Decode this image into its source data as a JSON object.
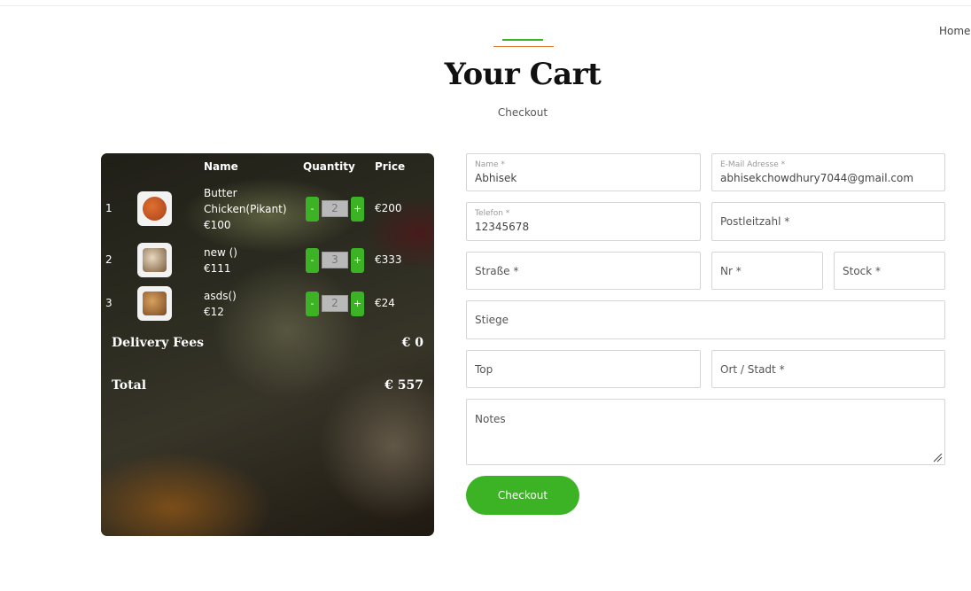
{
  "nav": {
    "home": "Home"
  },
  "header": {
    "title": "Your Cart",
    "subtitle": "Checkout"
  },
  "cart": {
    "headers": {
      "name": "Name",
      "quantity": "Quantity",
      "price": "Price"
    },
    "items": [
      {
        "index": "1",
        "name": "Butter Chicken(Pikant)",
        "unit_price": "€100",
        "qty_minus": "-",
        "qty": "2",
        "qty_plus": "+",
        "total": "€200",
        "thumb_color": "#c85a1a"
      },
      {
        "index": "2",
        "name": "new ()",
        "unit_price": "€111",
        "qty_minus": "-",
        "qty": "3",
        "qty_plus": "+",
        "total": "€333",
        "thumb_color": "#b99a7a"
      },
      {
        "index": "3",
        "name": "asds()",
        "unit_price": "€12",
        "qty_minus": "-",
        "qty": "2",
        "qty_plus": "+",
        "total": "€24",
        "thumb_color": "#a06a3a"
      }
    ],
    "delivery_label": "Delivery Fees",
    "delivery_value": "€ 0",
    "total_label": "Total",
    "total_value": "€ 557"
  },
  "form": {
    "name": {
      "label": "Name *",
      "value": "Abhisek"
    },
    "email": {
      "label": "E-Mail Adresse *",
      "value": "abhisekchowdhury7044@gmail.com"
    },
    "phone": {
      "label": "Telefon *",
      "value": "12345678"
    },
    "postcode": {
      "placeholder": "Postleitzahl *"
    },
    "street": {
      "placeholder": "Straße *"
    },
    "number": {
      "placeholder": "Nr *"
    },
    "floor": {
      "placeholder": "Stock *"
    },
    "stairs": {
      "placeholder": "Stiege"
    },
    "top": {
      "placeholder": "Top"
    },
    "city": {
      "placeholder": "Ort / Stadt *"
    },
    "notes": {
      "placeholder": "Notes"
    },
    "submit": "Checkout"
  },
  "colors": {
    "accent": "#3bb324",
    "accent_line": "#e07a2c"
  }
}
